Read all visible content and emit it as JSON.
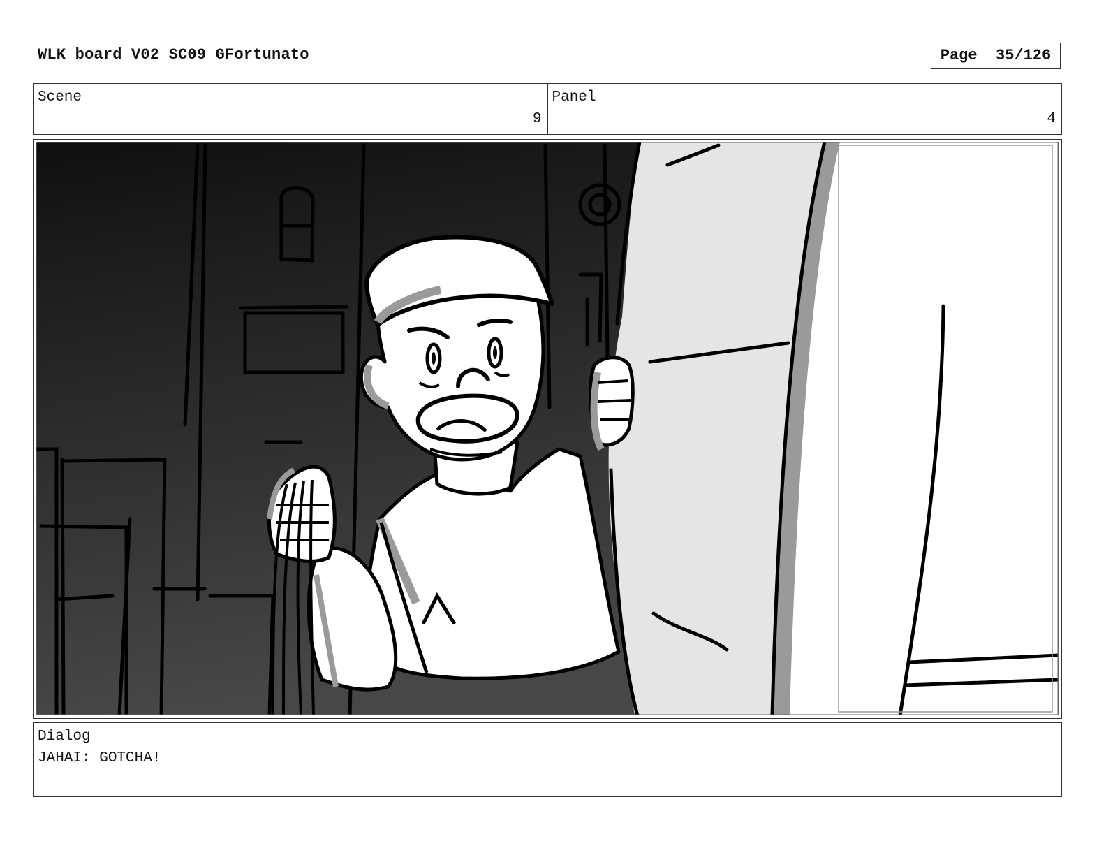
{
  "header": {
    "title": "WLK board V02 SC09 GFortunato",
    "page_label": "Page",
    "page_number": "35/126"
  },
  "scene": {
    "label": "Scene",
    "value": "9"
  },
  "panel": {
    "label": "Panel",
    "value": "4"
  },
  "dialog": {
    "label": "Dialog",
    "text": "JAHAI: GOTCHA!"
  },
  "colors": {
    "ink": "#111111",
    "frame_border": "#333333",
    "tone_dark": "#1a1a1a",
    "tone_mid": "#444444",
    "tone_light": "#e6e6e6",
    "shadow": "#999999"
  }
}
